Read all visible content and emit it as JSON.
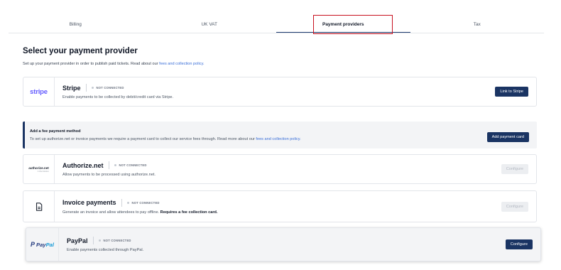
{
  "tabs": [
    {
      "label": "Billing"
    },
    {
      "label": "UK VAT"
    },
    {
      "label": "Payment providers"
    },
    {
      "label": "Tax"
    }
  ],
  "header": {
    "title": "Select your payment provider",
    "subtitle": "Set up your payment provider in order to publish paid tickets. Read about our ",
    "subtitle_link": "fees and collection policy."
  },
  "providers": {
    "stripe": {
      "logo": "stripe",
      "name": "Stripe",
      "status": "NOT CONNECTED",
      "description": "Enable payments to be collected by debit/credit card via Stripe.",
      "button": "Link to Stripe"
    },
    "authorize": {
      "logo_main": "authorize.net",
      "logo_sub": "A Visa Solution",
      "name": "Authorize.net",
      "status": "NOT CONNECTED",
      "description": "Allow payments to be processed using authorize.net.",
      "button": "Configure"
    },
    "invoice": {
      "icon": "document-icon",
      "name": "Invoice payments",
      "status": "NOT CONNECTED",
      "description": "Generate an invoice and allow attendees to pay offline. ",
      "description_bold": "Requires a fee collection card.",
      "button": "Configure"
    },
    "paypal": {
      "logo_p": "P",
      "logo_pay": "Pay",
      "logo_pal": "Pal",
      "name": "PayPal",
      "status": "NOT CONNECTED",
      "description": "Enable payments collected through PayPal.",
      "button": "Configure"
    }
  },
  "fee_notice": {
    "title": "Add a fee payment method",
    "text": "To set up authorize.net or invoice payments we require a payment card to collect our service fees through. Read more about our ",
    "link": "fees and collection policy.",
    "button": "Add payment card"
  },
  "colors": {
    "accent": "#1a3463",
    "link": "#3b6fd8",
    "highlight": "#c8101e",
    "stripe": "#635bff"
  }
}
